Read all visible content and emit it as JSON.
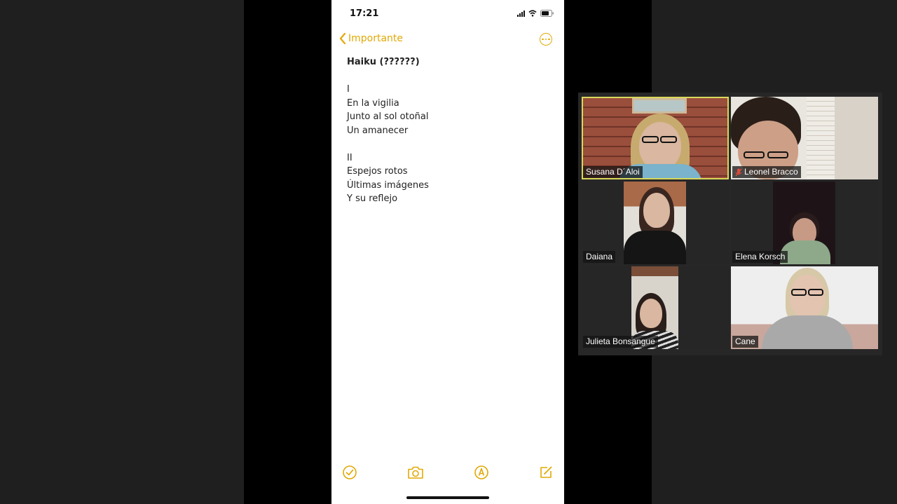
{
  "phone": {
    "status_time": "17:21",
    "nav_back_label": "Importante",
    "accent_color": "#e1a907",
    "note": {
      "title": "Haiku (??????)",
      "stanzas": [
        [
          "I",
          "En la vigilia",
          "Junto al sol otoñal",
          "Un amanecer"
        ],
        [
          "II",
          "Espejos rotos",
          "Últimas imágenes",
          "Y su reflejo"
        ]
      ]
    },
    "toolbar_icons": [
      "checklist-icon",
      "camera-icon",
      "markup-icon",
      "compose-icon"
    ]
  },
  "gallery": {
    "participants": [
      {
        "name": "Susana D´Aloi",
        "active": true,
        "muted": false
      },
      {
        "name": "Leonel Bracco",
        "active": false,
        "muted": true
      },
      {
        "name": "Daiana",
        "active": false,
        "muted": false
      },
      {
        "name": "Elena Korsch",
        "active": false,
        "muted": false
      },
      {
        "name": "Julieta Bonsangue",
        "active": false,
        "muted": false
      },
      {
        "name": "Cane",
        "active": false,
        "muted": false
      }
    ],
    "active_speaker_color": "#d8d85a"
  }
}
